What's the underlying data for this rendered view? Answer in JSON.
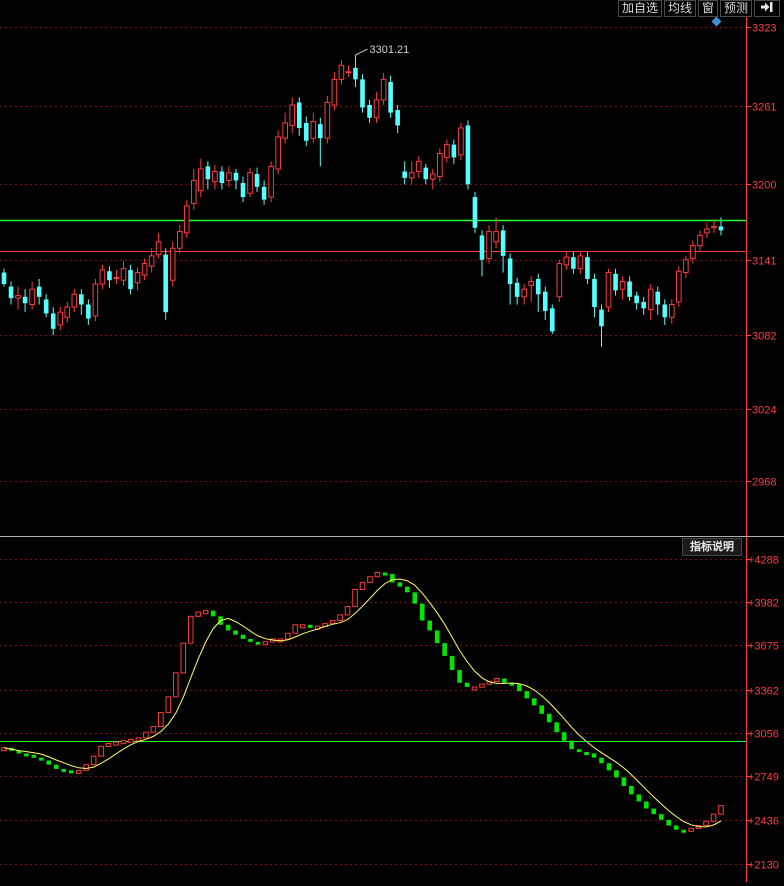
{
  "toolbar": {
    "add_watch": "加自选",
    "ma_line": "均线",
    "window": "窗",
    "forecast": "预测",
    "exit_icon": "exit-icon"
  },
  "indicator_button": "指标说明",
  "colors": {
    "up": "#ff3b3b",
    "down": "#54ffff",
    "vol_down": "#00e600",
    "grid": "#7a1010",
    "axis": "#ff3b3b",
    "hline": "#22ff22",
    "ref": "#ff3b3b",
    "ma": "#ffff66"
  },
  "chart_data": [
    {
      "type": "candlestick",
      "high_label": "3301.21",
      "y_ticks": [
        "3323",
        "3261",
        "3200",
        "3141",
        "3082",
        "3024",
        "2968"
      ],
      "ylim": [
        2925,
        3330
      ],
      "hlines": [
        3172,
        3148
      ],
      "grid": true,
      "candles": [
        [
          3131,
          3122,
          3134,
          3120
        ],
        [
          3120,
          3111,
          3124,
          3106
        ],
        [
          3111,
          3113,
          3120,
          3102
        ],
        [
          3112,
          3107,
          3118,
          3100
        ],
        [
          3106,
          3118,
          3124,
          3102
        ],
        [
          3120,
          3112,
          3126,
          3106
        ],
        [
          3110,
          3099,
          3114,
          3096
        ],
        [
          3099,
          3087,
          3104,
          3082
        ],
        [
          3090,
          3100,
          3104,
          3086
        ],
        [
          3096,
          3104,
          3108,
          3092
        ],
        [
          3104,
          3114,
          3118,
          3100
        ],
        [
          3114,
          3106,
          3118,
          3098
        ],
        [
          3106,
          3095,
          3110,
          3090
        ],
        [
          3097,
          3122,
          3126,
          3093
        ],
        [
          3122,
          3133,
          3137,
          3118
        ],
        [
          3132,
          3125,
          3136,
          3119
        ],
        [
          3127,
          3127,
          3133,
          3122
        ],
        [
          3125,
          3134,
          3140,
          3121
        ],
        [
          3133,
          3118,
          3137,
          3114
        ],
        [
          3123,
          3131,
          3135,
          3117
        ],
        [
          3129,
          3138,
          3142,
          3125
        ],
        [
          3136,
          3144,
          3150,
          3131
        ],
        [
          3145,
          3155,
          3162,
          3142
        ],
        [
          3145,
          3100,
          3150,
          3094
        ],
        [
          3125,
          3150,
          3155,
          3120
        ],
        [
          3150,
          3163,
          3168,
          3146
        ],
        [
          3162,
          3183,
          3188,
          3158
        ],
        [
          3185,
          3203,
          3212,
          3180
        ],
        [
          3195,
          3212,
          3220,
          3190
        ],
        [
          3214,
          3204,
          3218,
          3196
        ],
        [
          3202,
          3210,
          3215,
          3196
        ],
        [
          3210,
          3201,
          3214,
          3196
        ],
        [
          3203,
          3209,
          3214,
          3198
        ],
        [
          3209,
          3203,
          3212,
          3196
        ],
        [
          3201,
          3190,
          3206,
          3186
        ],
        [
          3193,
          3209,
          3213,
          3190
        ],
        [
          3208,
          3198,
          3213,
          3194
        ],
        [
          3198,
          3188,
          3203,
          3184
        ],
        [
          3190,
          3214,
          3218,
          3186
        ],
        [
          3212,
          3237,
          3242,
          3208
        ],
        [
          3236,
          3248,
          3256,
          3232
        ],
        [
          3246,
          3262,
          3268,
          3240
        ],
        [
          3264,
          3244,
          3268,
          3238
        ],
        [
          3248,
          3234,
          3253,
          3230
        ],
        [
          3236,
          3249,
          3256,
          3232
        ],
        [
          3247,
          3236,
          3252,
          3214
        ],
        [
          3236,
          3264,
          3269,
          3232
        ],
        [
          3262,
          3282,
          3288,
          3258
        ],
        [
          3282,
          3293,
          3297,
          3278
        ],
        [
          3288,
          3288,
          3293,
          3284
        ],
        [
          3291,
          3282,
          3301,
          3276
        ],
        [
          3282,
          3260,
          3286,
          3256
        ],
        [
          3262,
          3252,
          3266,
          3248
        ],
        [
          3252,
          3266,
          3272,
          3248
        ],
        [
          3266,
          3282,
          3287,
          3262
        ],
        [
          3280,
          3256,
          3285,
          3252
        ],
        [
          3258,
          3246,
          3262,
          3240
        ],
        [
          3210,
          3205,
          3218,
          3200
        ],
        [
          3205,
          3209,
          3218,
          3200
        ],
        [
          3210,
          3218,
          3222,
          3205
        ],
        [
          3213,
          3204,
          3216,
          3200
        ],
        [
          3204,
          3208,
          3212,
          3196
        ],
        [
          3206,
          3224,
          3228,
          3202
        ],
        [
          3221,
          3231,
          3235,
          3217
        ],
        [
          3231,
          3221,
          3235,
          3216
        ],
        [
          3223,
          3244,
          3248,
          3219
        ],
        [
          3246,
          3200,
          3250,
          3196
        ],
        [
          3190,
          3166,
          3194,
          3162
        ],
        [
          3160,
          3141,
          3164,
          3128
        ],
        [
          3142,
          3163,
          3168,
          3138
        ],
        [
          3155,
          3163,
          3174,
          3150
        ],
        [
          3164,
          3144,
          3168,
          3131
        ],
        [
          3142,
          3122,
          3146,
          3106
        ],
        [
          3123,
          3112,
          3127,
          3106
        ],
        [
          3112,
          3118,
          3122,
          3106
        ],
        [
          3121,
          3124,
          3128,
          3108
        ],
        [
          3126,
          3114,
          3130,
          3100
        ],
        [
          3116,
          3101,
          3120,
          3094
        ],
        [
          3103,
          3085,
          3106,
          3083
        ],
        [
          3112,
          3138,
          3141,
          3108
        ],
        [
          3137,
          3143,
          3147,
          3133
        ],
        [
          3143,
          3134,
          3147,
          3130
        ],
        [
          3134,
          3144,
          3148,
          3130
        ],
        [
          3143,
          3126,
          3147,
          3122
        ],
        [
          3126,
          3104,
          3130,
          3096
        ],
        [
          3102,
          3089,
          3106,
          3073
        ],
        [
          3104,
          3131,
          3134,
          3100
        ],
        [
          3130,
          3117,
          3134,
          3113
        ],
        [
          3118,
          3124,
          3128,
          3110
        ],
        [
          3124,
          3112,
          3128,
          3109
        ],
        [
          3113,
          3107,
          3116,
          3102
        ],
        [
          3108,
          3103,
          3112,
          3098
        ],
        [
          3102,
          3118,
          3122,
          3094
        ],
        [
          3116,
          3106,
          3120,
          3098
        ],
        [
          3106,
          3096,
          3110,
          3090
        ],
        [
          3096,
          3106,
          3110,
          3091
        ],
        [
          3108,
          3132,
          3136,
          3104
        ],
        [
          3131,
          3141,
          3144,
          3127
        ],
        [
          3142,
          3152,
          3156,
          3138
        ],
        [
          3152,
          3160,
          3164,
          3148
        ],
        [
          3162,
          3165,
          3170,
          3158
        ],
        [
          3166,
          3167,
          3172,
          3162
        ],
        [
          3167,
          3164,
          3174,
          3160
        ]
      ]
    },
    {
      "type": "bar",
      "indicator": "volume-like",
      "y_ticks": [
        "+4288",
        "+3982",
        "+3675",
        "+3362",
        "+3056",
        "+2749",
        "+2436",
        "+2130"
      ],
      "ylim": [
        2000,
        4420
      ],
      "hline": 3000,
      "grid": true,
      "values": [
        2950,
        2930,
        2910,
        2900,
        2880,
        2860,
        2830,
        2800,
        2790,
        2780,
        2790,
        2830,
        2890,
        2960,
        2980,
        2990,
        3000,
        3010,
        3020,
        3060,
        3100,
        3200,
        3310,
        3480,
        3690,
        3880,
        3910,
        3920,
        3880,
        3820,
        3780,
        3750,
        3720,
        3700,
        3680,
        3700,
        3720,
        3720,
        3760,
        3820,
        3820,
        3810,
        3810,
        3830,
        3850,
        3890,
        3950,
        4070,
        4120,
        4160,
        4190,
        4180,
        4120,
        4090,
        4050,
        3970,
        3850,
        3780,
        3690,
        3600,
        3500,
        3410,
        3380,
        3380,
        3400,
        3420,
        3440,
        3410,
        3400,
        3350,
        3300,
        3250,
        3190,
        3130,
        3060,
        3000,
        2940,
        2920,
        2910,
        2880,
        2840,
        2790,
        2740,
        2680,
        2620,
        2570,
        2520,
        2480,
        2440,
        2400,
        2370,
        2360,
        2380,
        2400,
        2430,
        2480,
        2540
      ]
    }
  ]
}
